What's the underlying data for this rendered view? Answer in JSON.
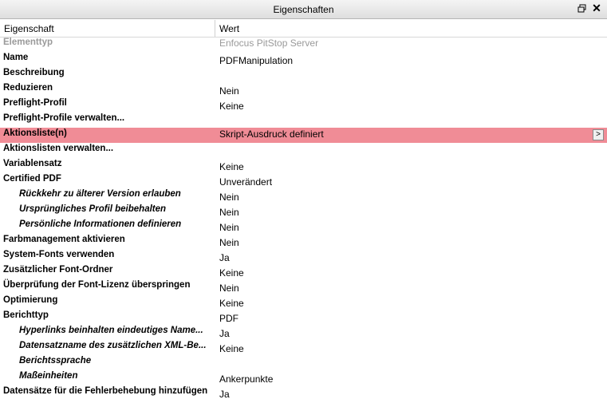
{
  "panel": {
    "title": "Eigenschaften",
    "float_icon": "float-window-icon",
    "close_icon": "close-icon"
  },
  "header": {
    "col_property": "Eigenschaft",
    "col_value": "Wert"
  },
  "rows": [
    {
      "property": "Elementtyp",
      "value": "Enfocus PitStop Server",
      "disabled": true
    },
    {
      "property": "Name",
      "value": "PDFManipulation"
    },
    {
      "property": "Beschreibung",
      "value": ""
    },
    {
      "property": "Reduzieren",
      "value": "Nein"
    },
    {
      "property": "Preflight-Profil",
      "value": "Keine"
    },
    {
      "property": "Preflight-Profile verwalten...",
      "value": ""
    },
    {
      "property": "Aktionsliste(n)",
      "value": "Skript-Ausdruck definiert",
      "highlighted": true,
      "button": ">"
    },
    {
      "property": "Aktionslisten verwalten...",
      "value": ""
    },
    {
      "property": "Variablensatz",
      "value": "Keine"
    },
    {
      "property": "Certified PDF",
      "value": "Unverändert"
    },
    {
      "property": "Rückkehr zu älterer Version erlauben",
      "value": "Nein",
      "sub": true
    },
    {
      "property": "Ursprüngliches Profil beibehalten",
      "value": "Nein",
      "sub": true
    },
    {
      "property": "Persönliche Informationen definieren",
      "value": "Nein",
      "sub": true
    },
    {
      "property": "Farbmanagement aktivieren",
      "value": "Nein"
    },
    {
      "property": "System-Fonts verwenden",
      "value": "Ja"
    },
    {
      "property": "Zusätzlicher Font-Ordner",
      "value": "Keine"
    },
    {
      "property": "Überprüfung der Font-Lizenz überspringen",
      "value": "Nein"
    },
    {
      "property": "Optimierung",
      "value": "Keine"
    },
    {
      "property": "Berichttyp",
      "value": "PDF"
    },
    {
      "property": "Hyperlinks beinhalten eindeutiges Name...",
      "value": "Ja",
      "sub": true
    },
    {
      "property": "Datensatzname des zusätzlichen XML-Be...",
      "value": "Keine",
      "sub": true
    },
    {
      "property": "Berichtssprache",
      "value": "",
      "sub": true
    },
    {
      "property": "Maßeinheiten",
      "value": "Ankerpunkte",
      "sub": true
    },
    {
      "property": "Datensätze für die Fehlerbehebung hinzufügen",
      "value": "Ja"
    }
  ]
}
